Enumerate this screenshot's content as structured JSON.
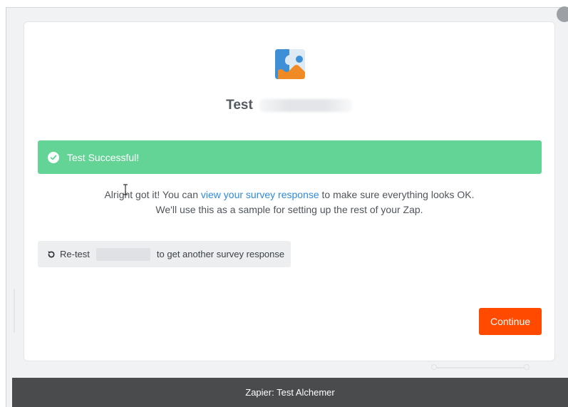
{
  "window": {
    "footer_title": "Zapier: Test Alchemer"
  },
  "header": {
    "title_prefix": "Test",
    "logo_icon": "alchemer-puzzle-icon"
  },
  "banner": {
    "status_icon": "check-circle-icon",
    "text": "Test Successful!",
    "color": "#63d396"
  },
  "message": {
    "line1_before": "Alright got it! You can ",
    "line1_link": "view your survey response",
    "line1_after": " to make sure everything looks OK.",
    "line2": "We'll use this as a sample for setting up the rest of your Zap."
  },
  "retest": {
    "icon": "refresh-icon",
    "label_before": "Re-test",
    "label_after": "to get another survey response"
  },
  "actions": {
    "continue_label": "Continue",
    "continue_color": "#ff4a00"
  }
}
